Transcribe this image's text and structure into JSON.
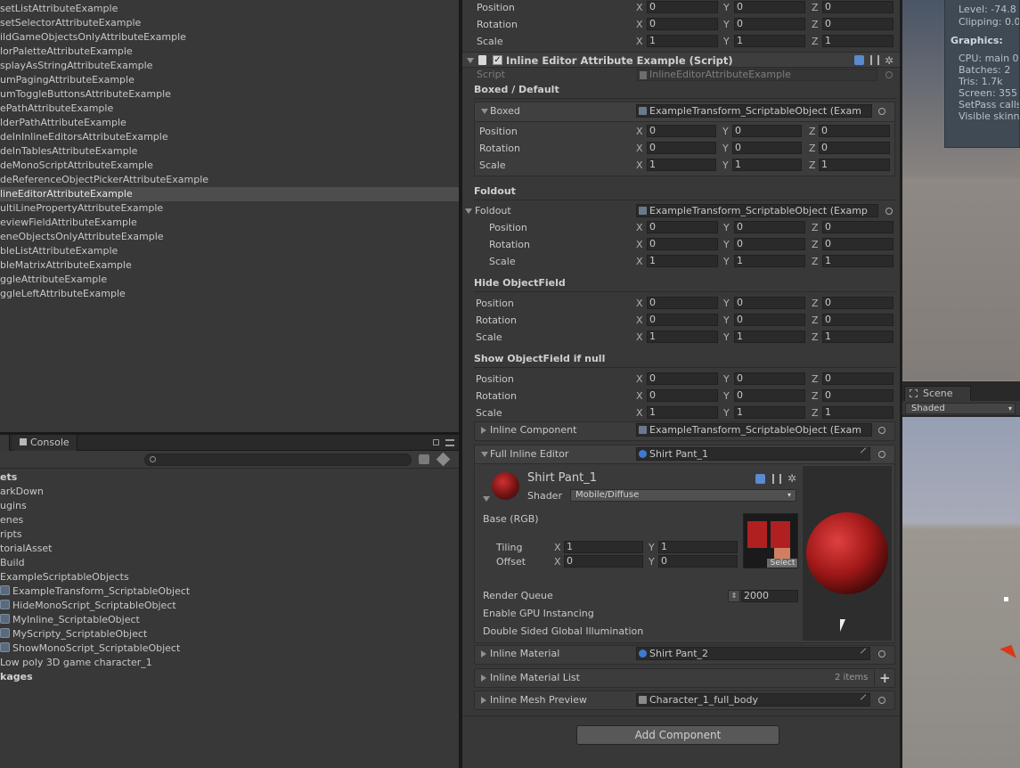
{
  "hierarchy": {
    "items": [
      "setListAttributeExample",
      "setSelectorAttributeExample",
      "ildGameObjectsOnlyAttributeExample",
      "lorPaletteAttributeExample",
      "splayAsStringAttributeExample",
      "umPagingAttributeExample",
      "umToggleButtonsAttributeExample",
      "ePathAttributeExample",
      "lderPathAttributeExample",
      "deInInlineEditorsAttributeExample",
      "deInTablesAttributeExample",
      "deMonoScriptAttributeExample",
      "deReferenceObjectPickerAttributeExample",
      "lineEditorAttributeExample",
      "ultiLinePropertyAttributeExample",
      "eviewFieldAttributeExample",
      "eneObjectsOnlyAttributeExample",
      "bleListAttributeExample",
      "bleMatrixAttributeExample",
      "ggleAttributeExample",
      "ggleLeftAttributeExample"
    ],
    "selected_index": 13
  },
  "project": {
    "tab_console": "Console",
    "tree": [
      {
        "label": "ets",
        "bold": true,
        "indent": 0
      },
      {
        "label": "arkDown",
        "indent": 0
      },
      {
        "label": "ugins",
        "indent": 0
      },
      {
        "label": "enes",
        "indent": 0
      },
      {
        "label": "ripts",
        "indent": 0
      },
      {
        "label": "torialAsset",
        "indent": 0
      },
      {
        "label": "Build",
        "indent": 1
      },
      {
        "label": "ExampleScriptableObjects",
        "indent": 1
      },
      {
        "label": "ExampleTransform_ScriptableObject",
        "indent": 2,
        "icon": true
      },
      {
        "label": "HideMonoScript_ScriptableObject",
        "indent": 2,
        "icon": true
      },
      {
        "label": "MyInline_ScriptableObject",
        "indent": 2,
        "icon": true
      },
      {
        "label": "MyScripty_ScriptableObject",
        "indent": 2,
        "icon": true
      },
      {
        "label": "ShowMonoScript_ScriptableObject",
        "indent": 2,
        "icon": true
      },
      {
        "label": "Low poly 3D game character_1",
        "indent": 1
      },
      {
        "label": "kages",
        "bold": true,
        "indent": 0
      }
    ]
  },
  "labels": {
    "position": "Position",
    "rotation": "Rotation",
    "scale": "Scale",
    "x": "X",
    "y": "Y",
    "z": "Z",
    "zero": "0",
    "one": "1"
  },
  "inspector": {
    "component_title": "Inline Editor Attribute Example (Script)",
    "script_label": "Script",
    "script_value": "InlineEditorAttributeExample",
    "boxed_default": "Boxed / Default",
    "boxed": "Boxed",
    "foldout_header": "Foldout",
    "foldout": "Foldout",
    "hide_objectfield": "Hide ObjectField",
    "show_objectfield": "Show ObjectField if null",
    "inline_component": "Inline Component",
    "full_inline_editor": "Full Inline Editor",
    "example_transform": "ExampleTransform_ScriptableObject (Exam",
    "foldout_value": "ExampleTransform_ScriptableObject (Examp",
    "shirt1": "Shirt Pant_1",
    "shirt2": "Shirt Pant_2",
    "material": {
      "name": "Shirt Pant_1",
      "shader_label": "Shader",
      "shader_value": "Mobile/Diffuse",
      "base": "Base (RGB)",
      "tiling": "Tiling",
      "offset": "Offset",
      "tiling_x": "1",
      "tiling_y": "1",
      "offset_x": "0",
      "offset_y": "0",
      "select": "Select",
      "render_queue": "Render Queue",
      "render_queue_value": "2000",
      "gpu": "Enable GPU Instancing",
      "dsgi": "Double Sided Global Illumination"
    },
    "inline_material": "Inline Material",
    "inline_material_list": "Inline Material List",
    "items_count": "2 items",
    "inline_mesh_preview": "Inline Mesh Preview",
    "mesh_value": "Character_1_full_body",
    "add_component": "Add Component"
  },
  "stats": {
    "level": "Level: -74.8",
    "clipping": "Clipping: 0.0",
    "graphics": "Graphics:",
    "cpu": "CPU: main 0",
    "batches": "Batches: 2",
    "tris": "Tris: 1.7k",
    "screen": "Screen: 355",
    "setpass": "SetPass calls",
    "skinned": "Visible skinn"
  },
  "scene": {
    "tab": "Scene",
    "shaded": "Shaded"
  },
  "colors": {
    "panel": "#383838",
    "selection": "#4d4d4d",
    "accent": "#3f7ad0"
  }
}
